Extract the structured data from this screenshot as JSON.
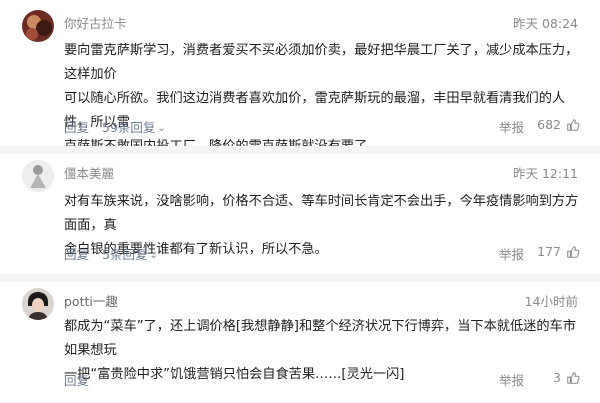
{
  "comments": [
    {
      "username": "你好古拉卡",
      "time": "昨天 08:24",
      "text_lines": [
        "要向雷克萨斯学习，消费者爱买不买必须加价卖，最好把华晨工厂关了，减少成本压力，这样加价",
        "可以随心所欲。我们这边消费者喜欢加价，雷克萨斯玩的最溜，丰田早就看清我们的人性，所以雷",
        "克萨斯不敢国内投工厂，降价的雷克萨斯就没有要了。"
      ],
      "reply_label": "回复",
      "replies_label": "59条回复",
      "report_label": "举报",
      "likes": "682"
    },
    {
      "username": "僵本美麗",
      "time": "昨天 12:11",
      "text_lines": [
        "对有车族来说，没啥影响，价格不合适、等车时间长肯定不会出手，今年疫情影响到方方面面，真",
        "金白银的重要性谁都有了新认识，所以不急。"
      ],
      "reply_label": "回复",
      "replies_label": "5条回复",
      "report_label": "举报",
      "likes": "177"
    },
    {
      "username": "potti一趣",
      "time": "14小时前",
      "text_lines": [
        "都成为“菜车”了，还上调价格[我想静静]和整个经济状况下行博弈，当下本就低迷的车市如果想玩",
        "一把“富贵险中求”饥饿营销只怕会自食苦果……[灵光一闪]"
      ],
      "reply_label": "回复",
      "report_label": "举报",
      "likes": "3"
    }
  ],
  "colors": {
    "link": "#6b7a8f",
    "meta": "#8a8a8a",
    "text": "#222222",
    "divider": "#f4f5f7"
  }
}
